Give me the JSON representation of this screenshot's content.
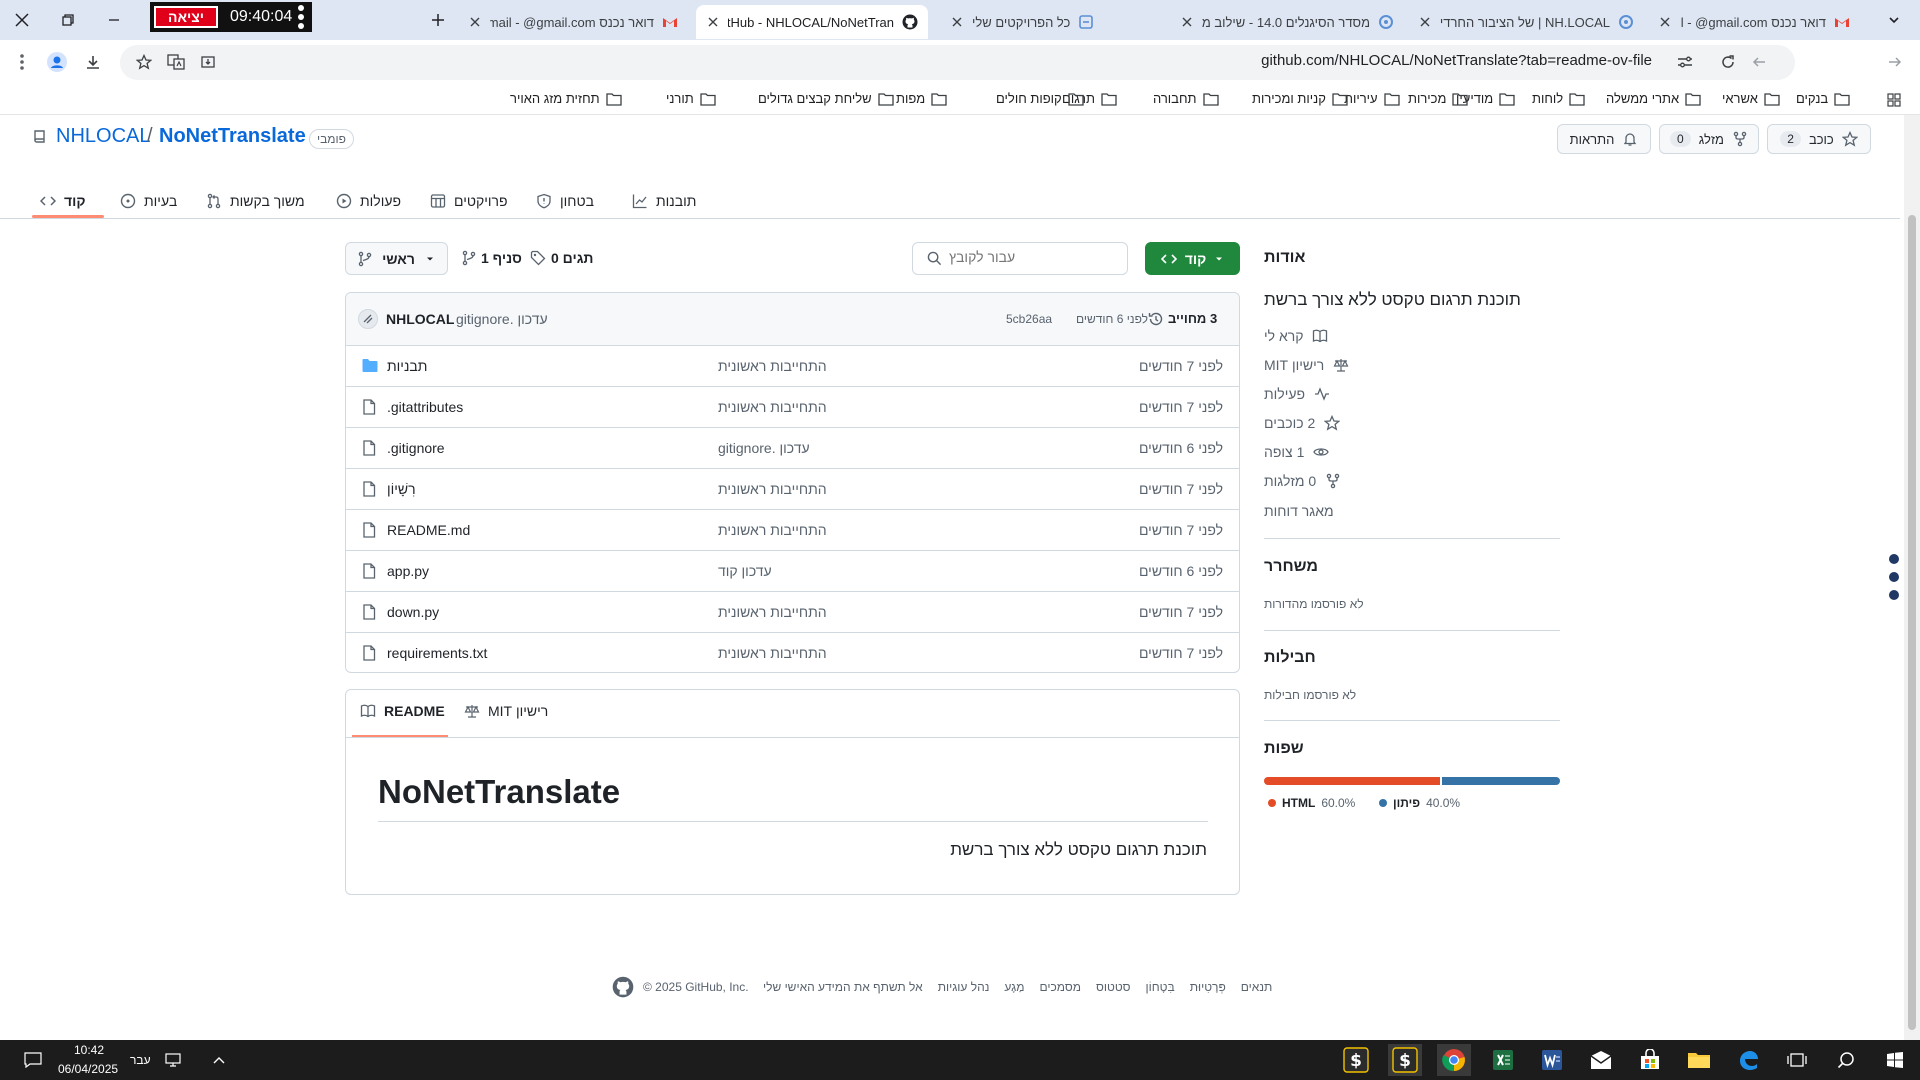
{
  "browser": {
    "tabs": [
      {
        "title": "דואר נכנס Gmail - @gmail.com",
        "icon": "gmail-icon"
      },
      {
        "title": "NH.LOCAL | של הציבור החרדי",
        "icon": "site-icon"
      },
      {
        "title": "מסדר הסיגנלים 14.0 - שילוב מו",
        "icon": "site-icon"
      },
      {
        "title": "כל הפרויקטים שלי",
        "icon": "site-icon"
      },
      {
        "title": "GitHub - NHLOCAL/NoNetTran",
        "icon": "github-icon"
      },
      {
        "title": "דואר נכנס Gmail - @gmail.com",
        "icon": "gmail-icon"
      }
    ],
    "exit_label": "יציאה",
    "clock": "09:40:04",
    "url": "github.com/NHLOCAL/NoNetTranslate?tab=readme-ov-file",
    "bookmarks": [
      "בנקים",
      "אשראי",
      "אתרי ממשלה",
      "לוחות",
      "מודיעין",
      "מכירות",
      "עיריות",
      "קניות ומכירות",
      "תחבורה",
      "תרגום",
      "קופות חולים",
      "מפות",
      "שליחת קבצים גדולים",
      "תורני",
      "תחזית מזג האויר"
    ]
  },
  "repo": {
    "owner": "NHLOCAL",
    "separator": "/",
    "name": "NoNetTranslate",
    "visibility": "פומבי",
    "star_label": "כוכב",
    "star_count": "2",
    "fork_label": "מזלג",
    "fork_count": "0",
    "notify_label": "התראות",
    "nav": [
      "קוד",
      "בעיות",
      "משוך בקשות",
      "פעולות",
      "פרויקטים",
      "בטחון",
      "תובנות"
    ]
  },
  "toolbar": {
    "branch": "ראשי",
    "branches": "סניף 1",
    "tags": "תגים 0",
    "search_placeholder": "עבור לקובץ",
    "code_button": "קוד"
  },
  "commit": {
    "author": "NHLOCAL",
    "message": "עדכון .gitignore",
    "hash": "5cb26aa",
    "time": "לפני 6 חודשים",
    "commits": "3 מחוייב"
  },
  "files": [
    {
      "name": "תבניות",
      "type": "folder",
      "message": "התחייבות ראשונית",
      "time": "לפני 7 חודשים"
    },
    {
      "name": ".gitattributes",
      "type": "file",
      "message": "התחייבות ראשונית",
      "time": "לפני 7 חודשים"
    },
    {
      "name": ".gitignore",
      "type": "file",
      "message": "עדכון .gitignore",
      "time": "לפני 6 חודשים"
    },
    {
      "name": "רִשָׁיוֹן",
      "type": "file",
      "message": "התחייבות ראשונית",
      "time": "לפני 7 חודשים"
    },
    {
      "name": "README.md",
      "type": "file",
      "message": "התחייבות ראשונית",
      "time": "לפני 7 חודשים"
    },
    {
      "name": "app.py",
      "type": "file",
      "message": "עדכון קוד",
      "time": "לפני 6 חודשים"
    },
    {
      "name": "down.py",
      "type": "file",
      "message": "התחייבות ראשונית",
      "time": "לפני 7 חודשים"
    },
    {
      "name": "requirements.txt",
      "type": "file",
      "message": "התחייבות ראשונית",
      "time": "לפני 7 חודשים"
    }
  ],
  "readme": {
    "tab_readme": "README",
    "tab_license": "רישיון MIT",
    "title": "NoNetTranslate",
    "body": "תוכנת תרגום טקסט ללא צורך ברשת"
  },
  "about": {
    "heading": "אודות",
    "description": "תוכנת תרגום טקסט ללא צורך ברשת",
    "items": [
      "קרא לי",
      "רישיון MIT",
      "פעילות",
      "2 כוכבים",
      "1 צופה",
      "0 מזלגות"
    ],
    "report": "מאגר דוחות",
    "releases_heading": "משחרר",
    "releases_text": "לא פורסמו מהדורות",
    "packages_heading": "חבילות",
    "packages_text": "לא פורסמו חבילות",
    "languages_heading": "שפות",
    "languages": [
      {
        "name": "HTML",
        "percent": "60.0%",
        "value": 60,
        "color": "#e34c26"
      },
      {
        "name": "פיתון",
        "percent": "40.0%",
        "value": 40,
        "color": "#3572A5"
      }
    ]
  },
  "footer": {
    "copyright": "© 2025 GitHub, Inc.",
    "links": [
      "תנאים",
      "פְּרָטִיוּת",
      "בִּטָחוֹן",
      "סטטוס",
      "מסמכים",
      "מַגָע",
      "נהל עוגיות",
      "אל תשתף את המידע האישי שלי"
    ]
  },
  "taskbar": {
    "time": "10:42",
    "date": "06/04/2025",
    "lang": "עבר"
  }
}
